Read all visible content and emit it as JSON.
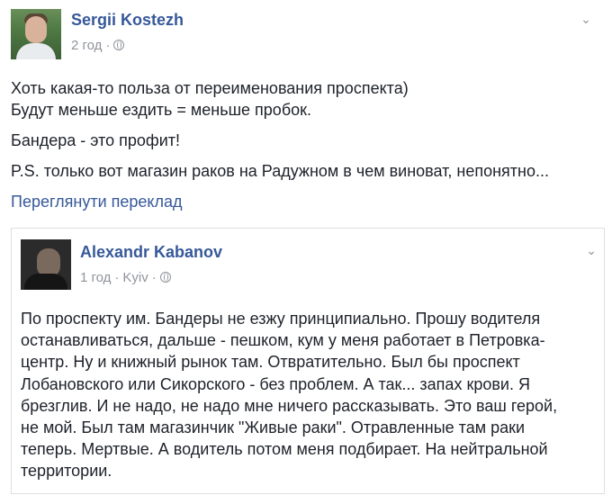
{
  "post": {
    "author": "Sergii Kostezh",
    "time": "2 год",
    "lines": [
      "Хоть какая-то польза от переименования проспекта)",
      "Будут меньше ездить = меньше пробок.",
      "Бандера - это профит!",
      "P.S. только вот магазин раков на Радужном в чем виноват, непонятно..."
    ],
    "translate_link": "Переглянути переклад"
  },
  "shared": {
    "author": "Alexandr Kabanov",
    "time": "1 год",
    "location": "Kyiv",
    "lines": [
      "По проспекту им. Бандеры не езжу принципиально. Прошу водителя",
      "останавливаться, дальше - пешком, кум у меня работает в Петровка-",
      "центр. Ну и книжный рынок там. Отвратительно. Был бы проспект",
      "Лобановского или Сикорского - без проблем. А так... запах крови. Я",
      "брезглив. И не надо, не надо мне ничего рассказывать. Это ваш герой,",
      "не мой. Был там магазинчик \"Живые раки\". Отравленные там раки",
      "теперь. Мертвые. А водитель потом меня подбирает. На нейтральной",
      "территории."
    ]
  },
  "icons": {
    "globe": "globe-icon",
    "chevron": "chevron-down-icon"
  },
  "colors": {
    "link": "#365899",
    "meta": "#90949c",
    "text": "#1d2129",
    "border": "#dddfe2"
  }
}
